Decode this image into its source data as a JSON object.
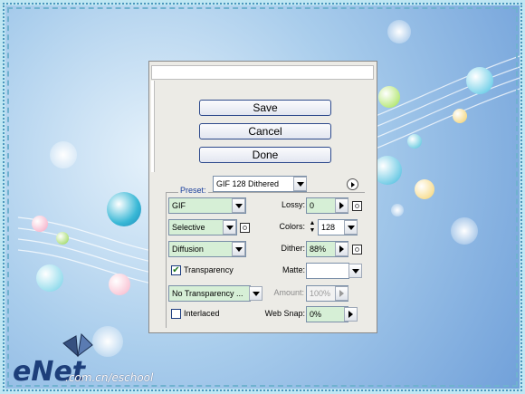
{
  "buttons": {
    "save": "Save",
    "cancel": "Cancel",
    "done": "Done"
  },
  "preset": {
    "label": "Preset:",
    "value": "GIF 128 Dithered"
  },
  "format": {
    "value": "GIF"
  },
  "lossy": {
    "label": "Lossy:",
    "value": "0"
  },
  "palette": {
    "value": "Selective"
  },
  "colors": {
    "label": "Colors:",
    "value": "128"
  },
  "dither_algo": {
    "value": "Diffusion"
  },
  "dither": {
    "label": "Dither:",
    "value": "88%"
  },
  "transparency": {
    "label": "Transparency",
    "checked": true
  },
  "matte": {
    "label": "Matte:",
    "value": ""
  },
  "transparency_dither": {
    "value": "No Transparency ...",
    "amount_label": "Amount:",
    "amount_value": "100%"
  },
  "interlaced": {
    "label": "Interlaced",
    "checked": false
  },
  "websnap": {
    "label": "Web Snap:",
    "value": "0%"
  },
  "watermark": {
    "logo": "eNet",
    "url": ".com.cn/eschool"
  },
  "colors_theme": {
    "field_bg": "#d6efd6",
    "button_border": "#2e4a8c",
    "preset_label": "#1a3f9c"
  }
}
